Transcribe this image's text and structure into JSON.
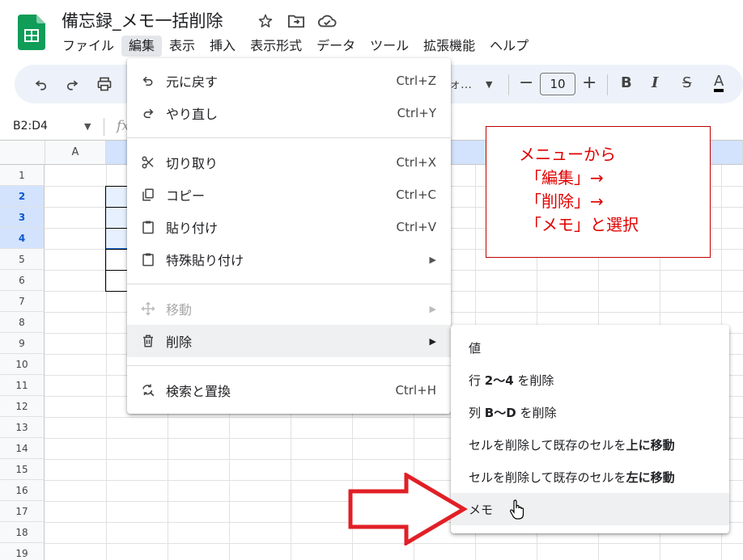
{
  "doc": {
    "title": "備忘録_メモ一括削除"
  },
  "menubar": [
    "ファイル",
    "編集",
    "表示",
    "挿入",
    "表示形式",
    "データ",
    "ツール",
    "拡張機能",
    "ヘルプ"
  ],
  "toolbar": {
    "font_fragment": "ォ…",
    "font_size": "10"
  },
  "namebox": "B2:D4",
  "fx": "fx",
  "columns": [
    "A"
  ],
  "rows": [
    "1",
    "2",
    "3",
    "4",
    "5",
    "6",
    "7",
    "8",
    "9",
    "10",
    "11",
    "12",
    "13",
    "14",
    "15",
    "16",
    "17",
    "18",
    "19"
  ],
  "edit_menu": [
    {
      "label": "元に戻す",
      "shortcut": "Ctrl+Z"
    },
    {
      "label": "やり直し",
      "shortcut": "Ctrl+Y"
    },
    {
      "label": "切り取り",
      "shortcut": "Ctrl+X"
    },
    {
      "label": "コピー",
      "shortcut": "Ctrl+C"
    },
    {
      "label": "貼り付け",
      "shortcut": "Ctrl+V"
    },
    {
      "label": "特殊貼り付け",
      "shortcut": ""
    },
    {
      "label": "移動",
      "shortcut": ""
    },
    {
      "label": "削除",
      "shortcut": ""
    },
    {
      "label": "検索と置換",
      "shortcut": "Ctrl+H"
    }
  ],
  "submenu": {
    "value": "値",
    "rows_pre": "行 ",
    "rows_bold": "2〜4",
    "rows_post": " を削除",
    "cols_pre": "列 ",
    "cols_bold": "B〜D",
    "cols_post": " を削除",
    "shift_up_pre": "セルを削除して既存のセルを",
    "shift_up_bold": "上に移動",
    "shift_left_pre": "セルを削除して既存のセルを",
    "shift_left_bold": "左に移動",
    "memo": "メモ"
  },
  "note": [
    "メニューから",
    "「編集」→",
    "「削除」→",
    "「メモ」と選択"
  ],
  "colors": {
    "annotation": "#e00000",
    "selection": "#1a73e8",
    "sheets_green": "#0f9d58"
  }
}
